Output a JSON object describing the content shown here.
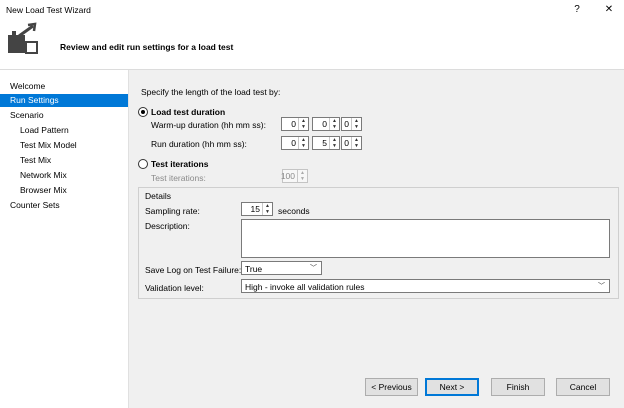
{
  "window": {
    "title": "New Load Test Wizard",
    "help_glyph": "?",
    "close_glyph": "✕"
  },
  "header": {
    "subtitle": "Review and edit run settings for a load test"
  },
  "sidebar": {
    "items": [
      {
        "label": "Welcome"
      },
      {
        "label": "Run Settings"
      },
      {
        "label": "Scenario"
      },
      {
        "label": "Load Pattern"
      },
      {
        "label": "Test Mix Model"
      },
      {
        "label": "Test Mix"
      },
      {
        "label": "Network Mix"
      },
      {
        "label": "Browser Mix"
      },
      {
        "label": "Counter Sets"
      }
    ],
    "selected": "Run Settings"
  },
  "main": {
    "intro": "Specify the length of the load test by:",
    "duration_option": {
      "label": "Load test duration",
      "selected": true,
      "warmup_label": "Warm-up duration (hh mm ss):",
      "warmup": {
        "hh": "0",
        "mm": "0",
        "ss": "0"
      },
      "run_label": "Run duration (hh mm ss):",
      "run": {
        "hh": "0",
        "mm": "5",
        "ss": "0"
      }
    },
    "iterations_option": {
      "label": "Test iterations",
      "selected": false,
      "iterations_label": "Test iterations:",
      "iterations_value": "100"
    },
    "details": {
      "legend": "Details",
      "sampling_label": "Sampling rate:",
      "sampling_value": "15",
      "sampling_unit": "seconds",
      "description_label": "Description:",
      "description_value": "",
      "save_log_label": "Save Log on Test Failure:",
      "save_log_value": "True",
      "validation_label": "Validation level:",
      "validation_value": "High - invoke all validation rules"
    }
  },
  "footer": {
    "previous": "< Previous",
    "next": "Next >",
    "finish": "Finish",
    "cancel": "Cancel"
  },
  "colors": {
    "selection": "#0078d7",
    "panel": "#f0f0f0"
  }
}
